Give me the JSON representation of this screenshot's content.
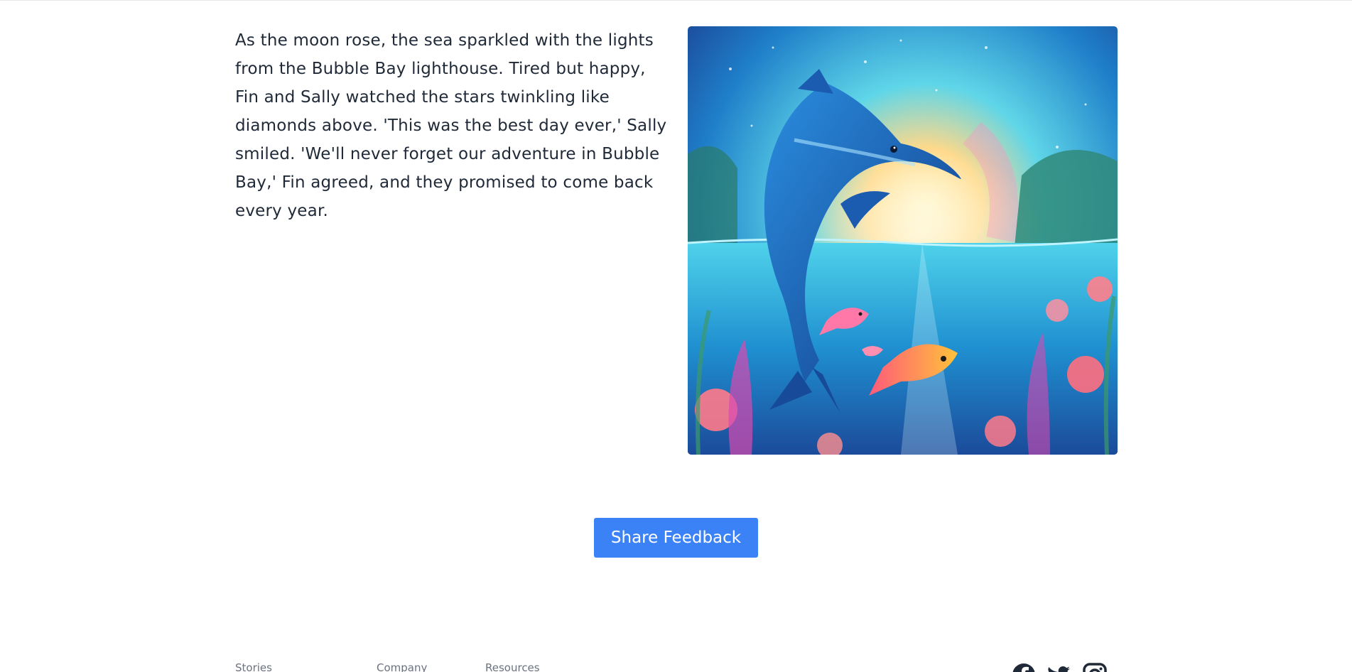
{
  "story": {
    "paragraph": "As the moon rose, the sea sparkled with the lights from the Bubble Bay lighthouse. Tired but happy, Fin and Sally watched the stars twinkling like diamonds above. 'This was the best day ever,' Sally smiled. 'We'll never forget our adventure in Bubble Bay,' Fin agreed, and they promised to come back every year."
  },
  "feedback": {
    "button_label": "Share Feedback"
  },
  "footer": {
    "columns": [
      {
        "heading": "Stories"
      },
      {
        "heading": "Company"
      },
      {
        "heading": "Resources"
      }
    ],
    "social_icons": [
      "facebook-icon",
      "twitter-icon",
      "instagram-icon"
    ]
  },
  "colors": {
    "accent": "#3b82f6",
    "text": "#1f2937",
    "muted": "#6b7280"
  }
}
